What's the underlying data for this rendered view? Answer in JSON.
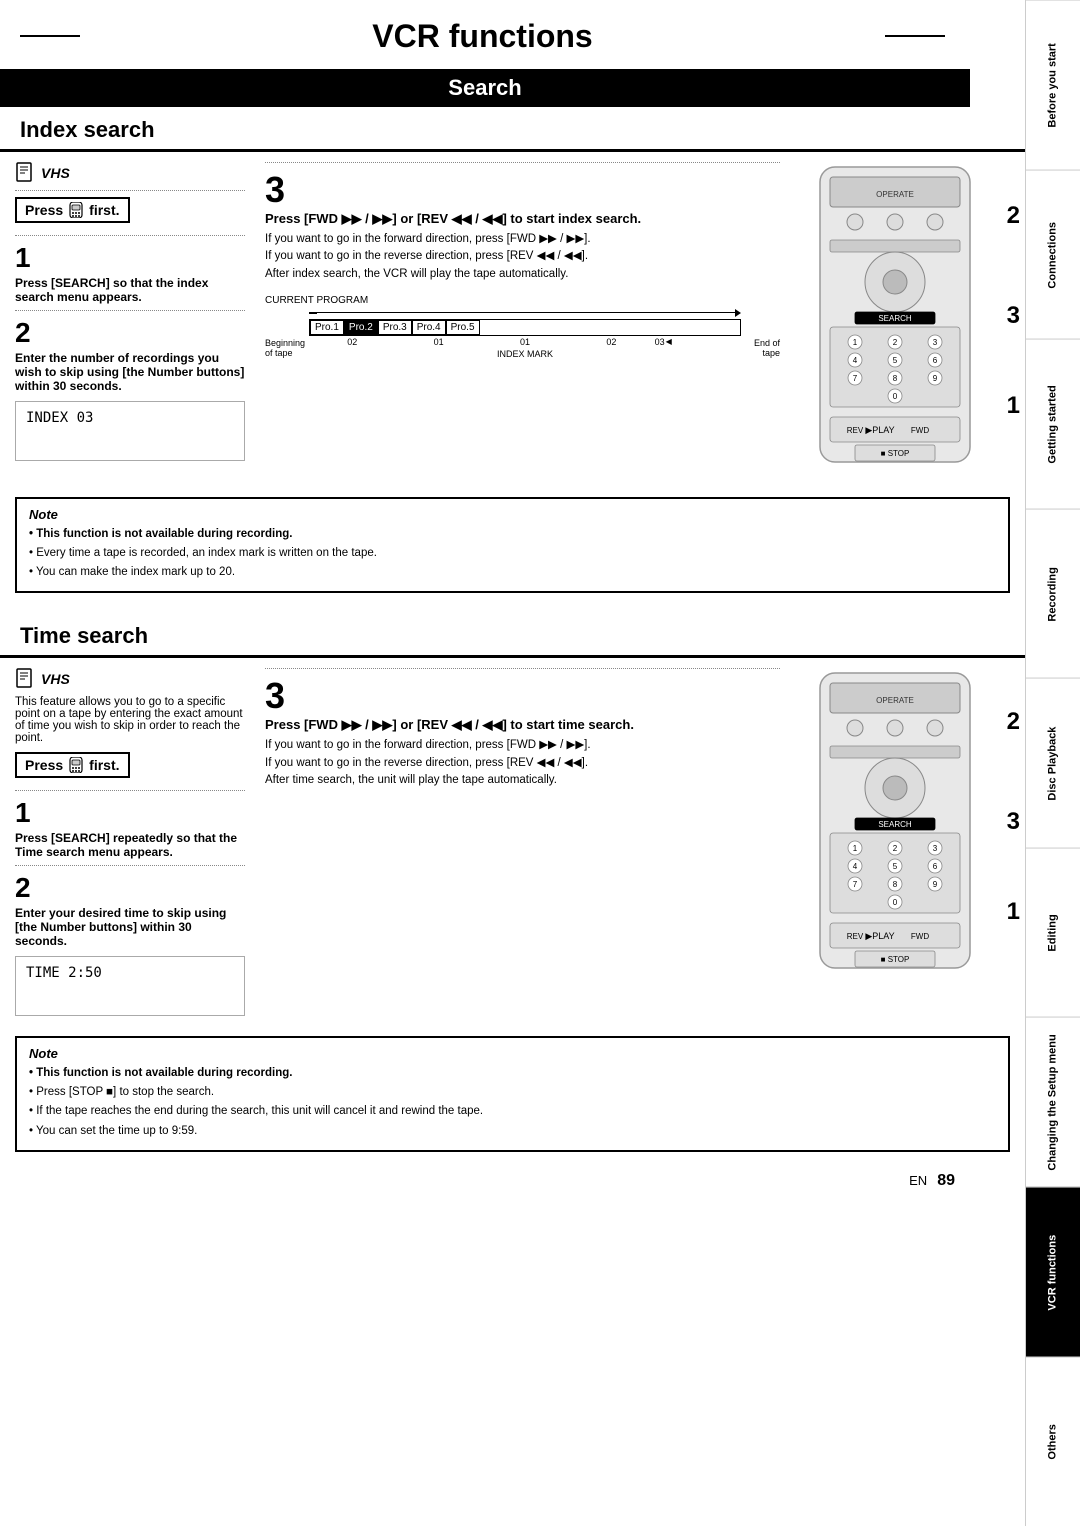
{
  "title": "VCR functions",
  "section": "Search",
  "index_search": {
    "heading": "Index search",
    "vhs_label": "VHS",
    "press_first": "Press",
    "press_first_suffix": "first.",
    "step1_num": "1",
    "step1_title": "Press [SEARCH] so that the index search menu appears.",
    "step2_num": "2",
    "step2_title": "Enter the number of recordings you wish to skip using [the Number buttons] within 30 seconds.",
    "index_display": "INDEX  03",
    "step3_num_mid": "3",
    "step3_title": "Press [FWD ▶▶ / ▶▶] or [REV ◀◀ / ◀◀] to start index search.",
    "step3_body_1": "If you want to go in the forward direction, press [FWD ▶▶ / ▶▶].",
    "step3_body_2": "If you want to go in the reverse direction, press [REV ◀◀ / ◀◀].",
    "step3_body_3": "After index search, the VCR will play the tape automatically.",
    "chart_label": "CURRENT PROGRAM",
    "chart_begin": "Beginning of tape",
    "chart_end": "End of tape",
    "chart_items": [
      "Pro.1",
      "Pro.2",
      "Pro.3",
      "Pro.4",
      "Pro.5"
    ],
    "chart_vals": [
      "02",
      "01",
      "01",
      "02",
      "03"
    ],
    "index_mark": "INDEX MARK",
    "diag_2": "2",
    "diag_3": "3",
    "diag_1": "1",
    "note_title": "Note",
    "note_bold": "This function is not available during recording.",
    "note_1": "Every time a tape is recorded, an index mark is written on the tape.",
    "note_2": "You can make the index mark up to 20."
  },
  "time_search": {
    "heading": "Time search",
    "vhs_label": "VHS",
    "intro": "This feature allows you to go to a specific point on a tape by entering the exact amount of time you wish to skip in order to reach the point.",
    "press_first": "Press",
    "press_first_suffix": "first.",
    "step1_num": "1",
    "step1_title": "Press [SEARCH] repeatedly so that the Time search menu appears.",
    "step2_num": "2",
    "step2_title": "Enter your desired time to skip using [the Number buttons] within 30 seconds.",
    "time_display": "TIME  2:50",
    "step3_num_mid": "3",
    "step3_title": "Press [FWD ▶▶ / ▶▶] or [REV ◀◀ / ◀◀] to start time search.",
    "step3_body_1": "If you want to go in the forward direction, press [FWD ▶▶ / ▶▶].",
    "step3_body_2": "If you want to go in the reverse direction, press [REV ◀◀ / ◀◀].",
    "step3_body_3": "After time search, the unit will play the tape automatically.",
    "diag_2": "2",
    "diag_3": "3",
    "diag_1": "1",
    "note_title": "Note",
    "note_bold": "This function is not available during recording.",
    "note_1": "Press [STOP ■] to stop the search.",
    "note_2": "If the tape reaches the end during the search, this unit will cancel it and rewind the tape.",
    "note_3": "You can set the time up to 9:59."
  },
  "sidebar": {
    "items": [
      {
        "label": "Before you start"
      },
      {
        "label": "Connections"
      },
      {
        "label": "Getting started"
      },
      {
        "label": "Recording"
      },
      {
        "label": "Disc Playback"
      },
      {
        "label": "Editing"
      },
      {
        "label": "Changing the Setup menu"
      },
      {
        "label": "VCR functions",
        "active": true
      },
      {
        "label": "Others"
      }
    ]
  },
  "footer": {
    "lang": "EN",
    "page": "89"
  }
}
